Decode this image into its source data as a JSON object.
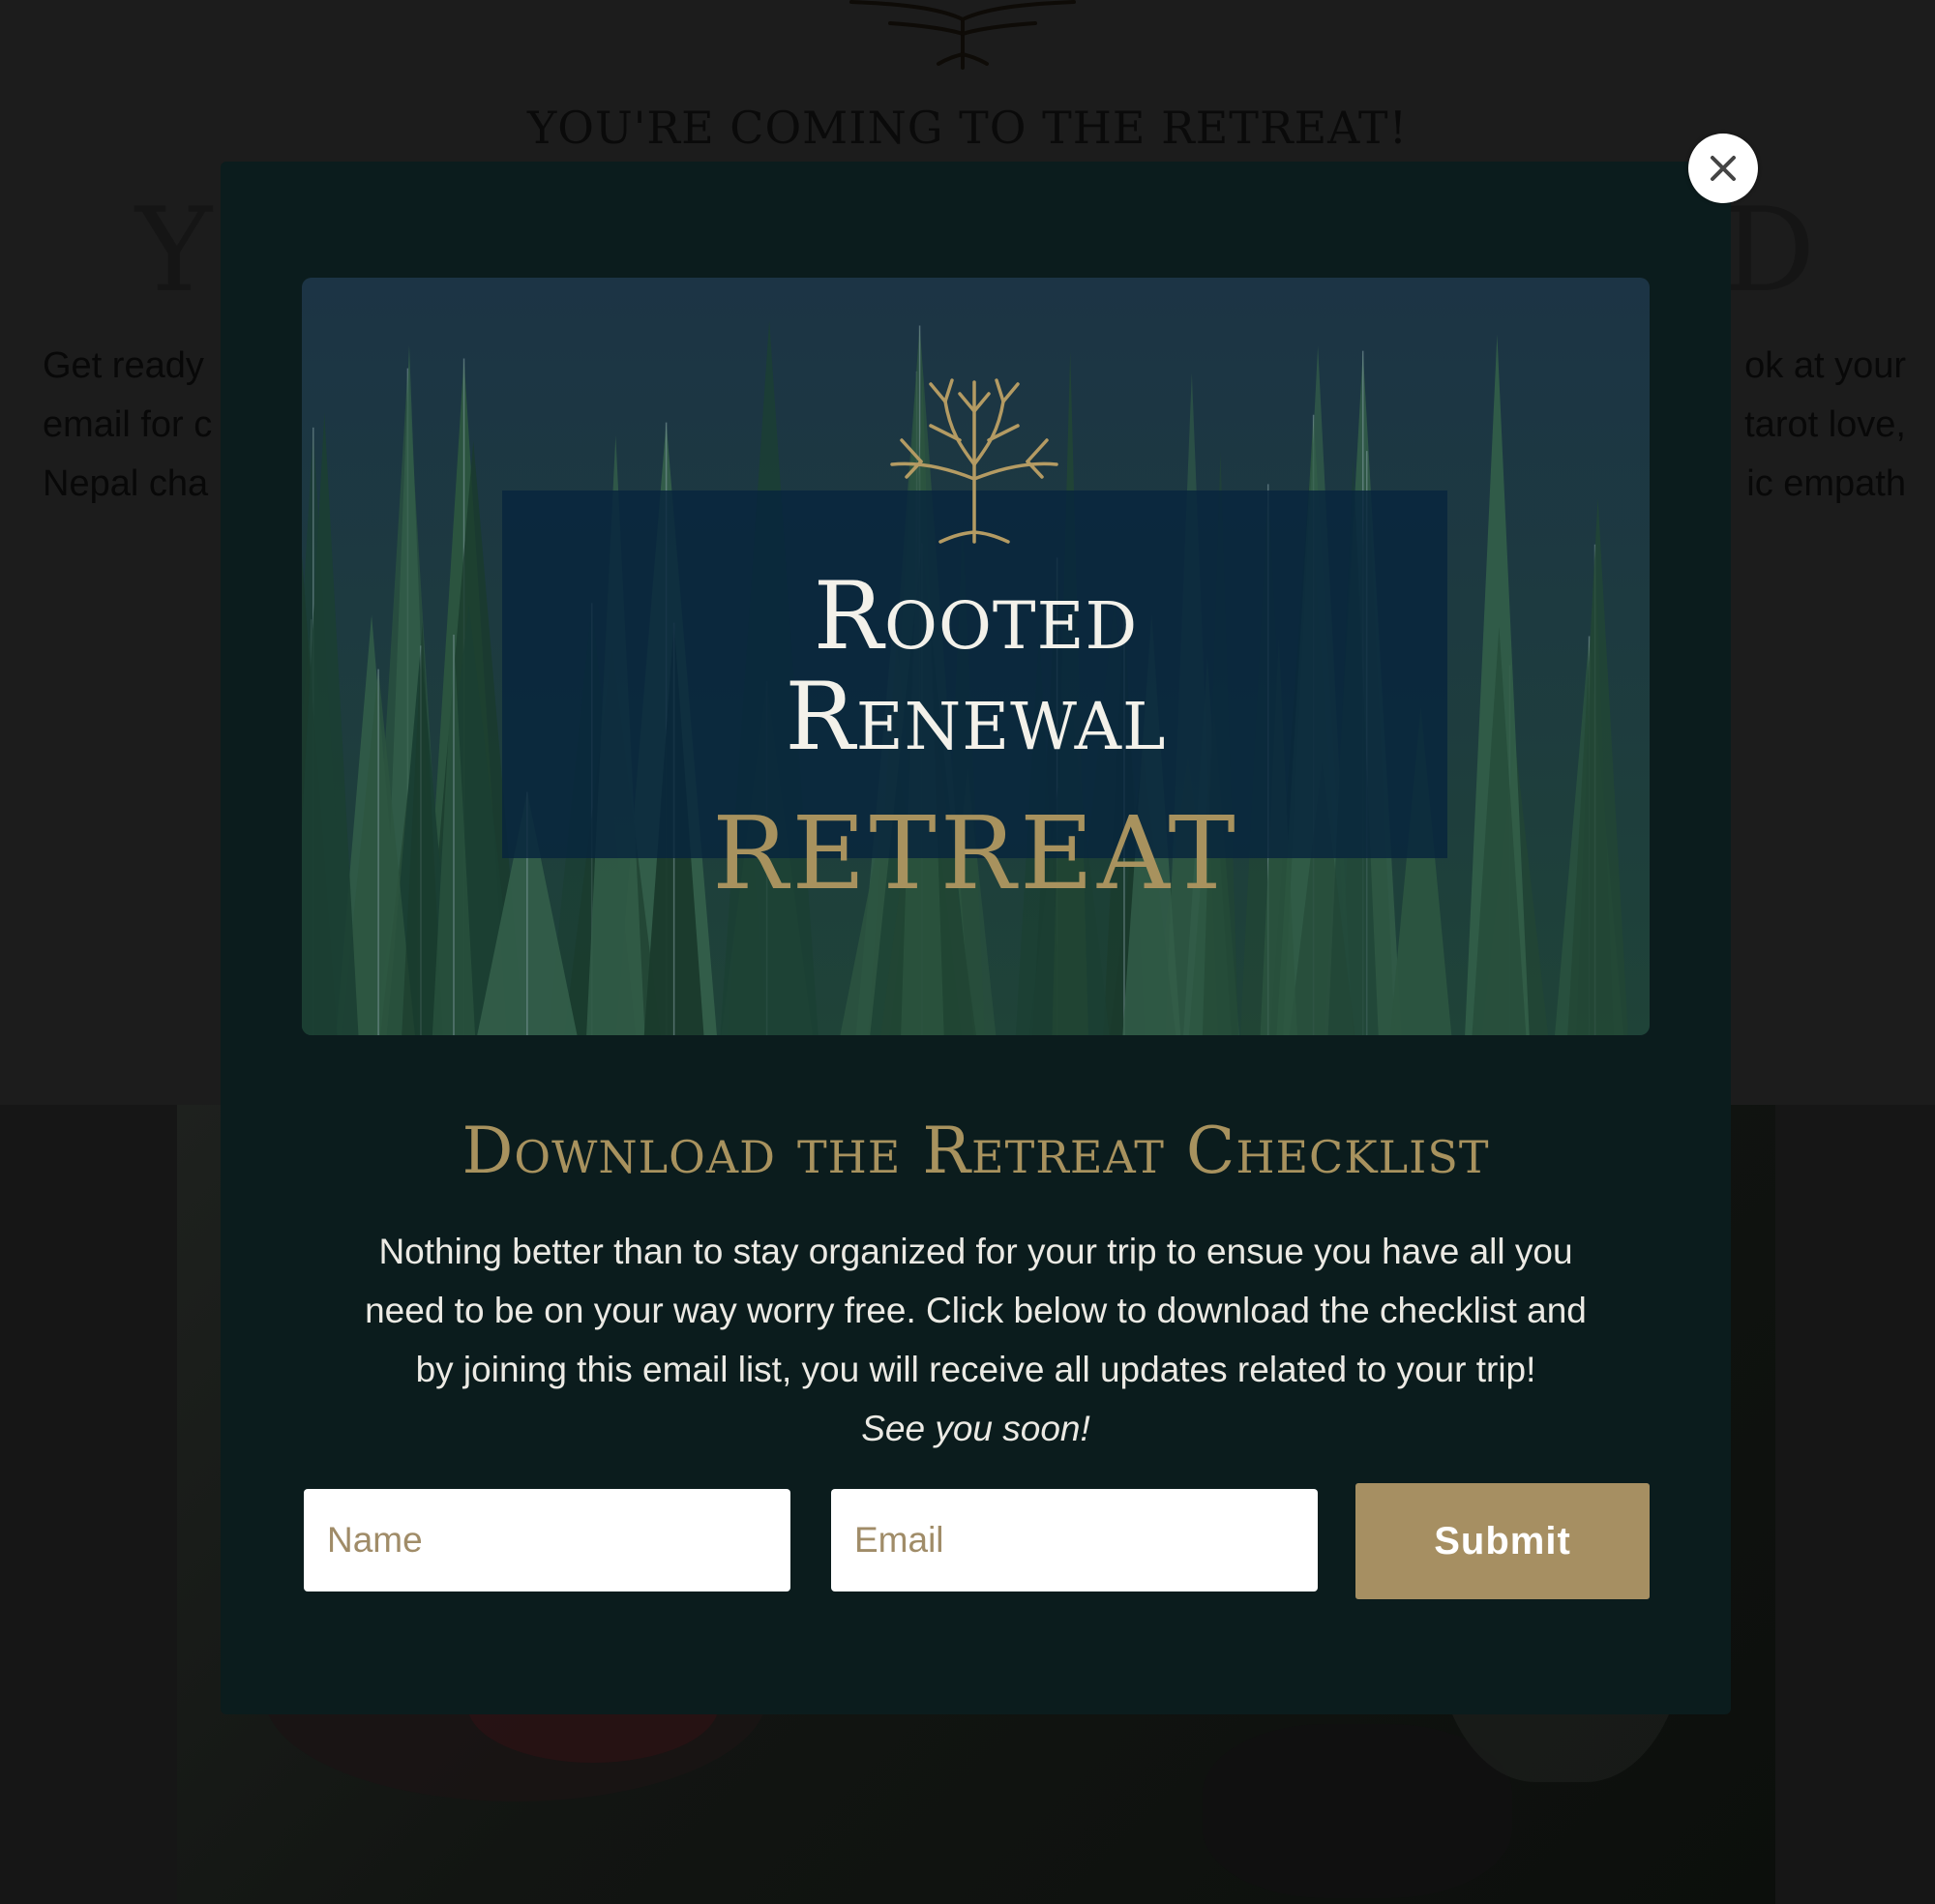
{
  "background": {
    "subheading": "YOU'RE COMING TO THE RETREAT!",
    "heading_left_fragment": "Y",
    "heading_right_fragment": "D",
    "para_left_lines": [
      "Get ready",
      "email for c",
      "Nepal cha"
    ],
    "para_right_lines": [
      "ok at your",
      "tarot love,",
      "ic empath"
    ]
  },
  "modal": {
    "hero": {
      "line1": "Rooted",
      "line2": "Renewal",
      "line3": "RETREAT"
    },
    "heading": "Download the Retreat Checklist",
    "text_lines": [
      "Nothing better than to stay organized for your trip to ensue you have all you",
      "need to be on your way worry free. Click below to download the checklist and",
      "by joining this email list, you will receive all updates related to your trip!"
    ],
    "text_italic": "See you soon!",
    "form": {
      "name_placeholder": "Name",
      "email_placeholder": "Email",
      "submit_label": "Submit"
    }
  },
  "colors": {
    "modal_bg": "#0b1c1d",
    "accent_gold": "#a68f62",
    "hero_panel": "#07243d"
  },
  "icons": {
    "close": "close-icon",
    "logo": "tree-logo-icon"
  }
}
